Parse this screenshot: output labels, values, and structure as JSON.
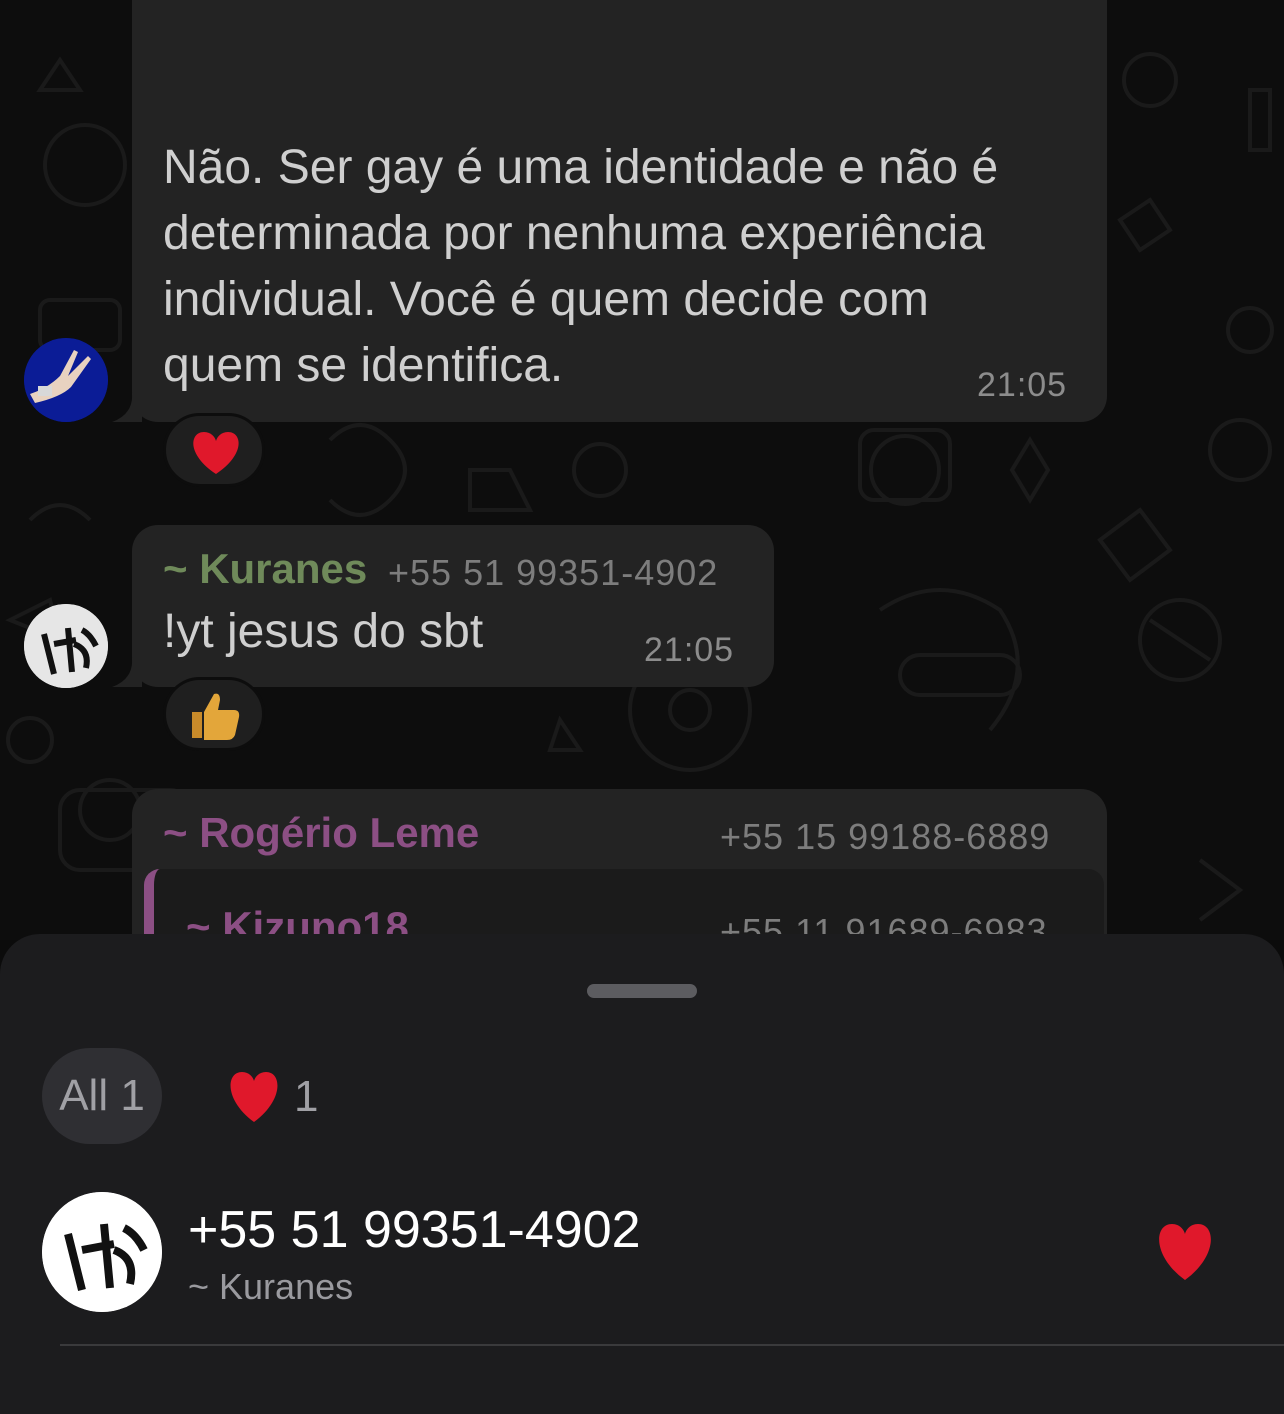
{
  "messages": [
    {
      "text_lines": [
        "Não. Ser gay é uma identidade e não é",
        "determinada por nenhuma experiência",
        "individual. Você é quem decide com",
        "quem se identifica."
      ],
      "time": "21:05",
      "reaction": "heart-emoji"
    },
    {
      "sender": "~ Kuranes",
      "phone": "+55 51 99351-4902",
      "text": "!yt jesus do sbt",
      "time": "21:05",
      "reaction": "thumbs-up-emoji"
    },
    {
      "sender": "~ Rogério Leme",
      "phone": "+55 15 99188-6889",
      "quoted_sender": "~ Kizuno18",
      "quoted_phone": "+55 11 91689-6983"
    }
  ],
  "sheet": {
    "tab_all_label": "All 1",
    "tab_heart_count": "1",
    "reactor": {
      "phone": "+55 51 99351-4902",
      "name": "~ Kuranes",
      "reaction": "heart-emoji"
    }
  },
  "colors": {
    "kuranes_name": "#6f8a5a",
    "rogerio_name": "#8c4f84",
    "bubble": "#232323",
    "sheet": "#1c1c1e"
  }
}
